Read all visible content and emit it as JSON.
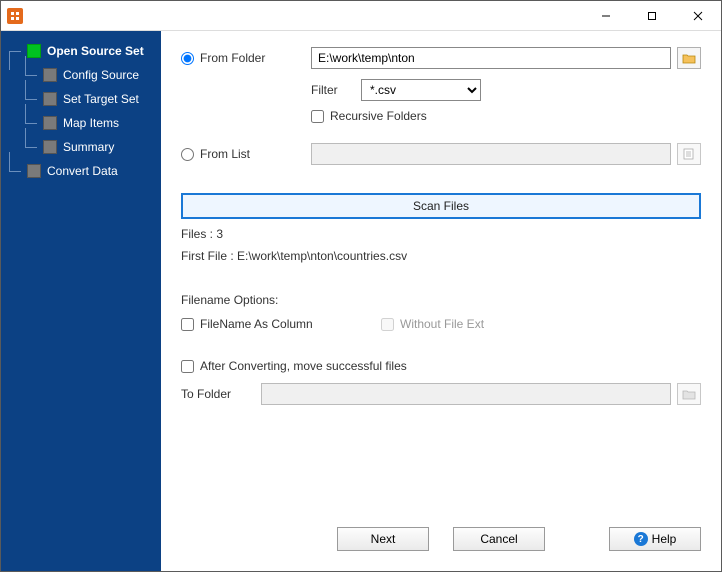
{
  "sidebar": {
    "items": [
      {
        "label": "Open Source Set",
        "level": 0,
        "active": true
      },
      {
        "label": "Config Source",
        "level": 1,
        "active": false
      },
      {
        "label": "Set Target Set",
        "level": 1,
        "active": false
      },
      {
        "label": "Map Items",
        "level": 1,
        "active": false
      },
      {
        "label": "Summary",
        "level": 1,
        "active": false
      },
      {
        "label": "Convert Data",
        "level": 0,
        "active": false
      }
    ]
  },
  "main": {
    "from_folder_label": "From Folder",
    "folder_path": "E:\\work\\temp\\nton",
    "filter_label": "Filter",
    "filter_value": "*.csv",
    "recursive_label": "Recursive Folders",
    "from_list_label": "From List",
    "list_path": "",
    "scan_label": "Scan Files",
    "files_line": "Files : 3",
    "first_file_line": "First File : E:\\work\\temp\\nton\\countries.csv",
    "filename_options_label": "Filename Options:",
    "filename_as_column_label": "FileName As Column",
    "without_ext_label": "Without File Ext",
    "after_convert_label": "After Converting, move successful files",
    "to_folder_label": "To Folder",
    "to_folder_path": ""
  },
  "buttons": {
    "next": "Next",
    "cancel": "Cancel",
    "help": "Help"
  }
}
